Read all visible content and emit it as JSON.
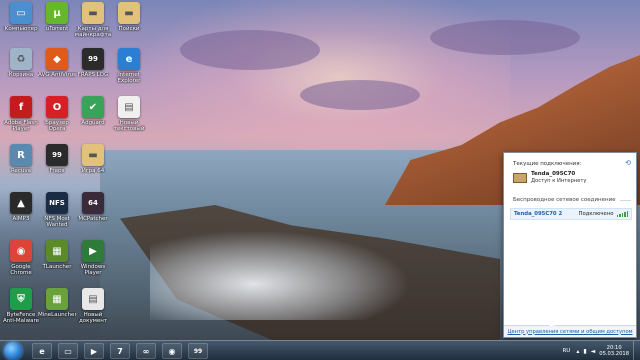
{
  "desktop": {
    "icons": [
      {
        "label": "Компьютер",
        "icon": "computer-icon",
        "color": "#4a8fd0",
        "glyph": "▭"
      },
      {
        "label": "Корзина",
        "icon": "recycle-bin-icon",
        "color": "#9fb4c8",
        "glyph": "♻"
      },
      {
        "label": "Adobe Flash Player",
        "icon": "flash-player-icon",
        "color": "#c21c1c",
        "glyph": "f"
      },
      {
        "label": "Recuva",
        "icon": "recuva-icon",
        "color": "#5a8ab0",
        "glyph": "R"
      },
      {
        "label": "AIMP3",
        "icon": "aimp-icon",
        "color": "#2a2a2a",
        "glyph": "▲"
      },
      {
        "label": "Google Chrome",
        "icon": "chrome-icon",
        "color": "#db4437",
        "glyph": "◉"
      },
      {
        "label": "ByteFence Anti-Malware",
        "icon": "bytefence-icon",
        "color": "#1e9e4a",
        "glyph": "⛨"
      },
      {
        "label": "uTorrent",
        "icon": "utorrent-icon",
        "color": "#67b72a",
        "glyph": "µ"
      },
      {
        "label": "AVG AntiVirus",
        "icon": "avg-icon",
        "color": "#e05a1a",
        "glyph": "◆"
      },
      {
        "label": "Браузер Opera",
        "icon": "opera-icon",
        "color": "#d81f26",
        "glyph": "O"
      },
      {
        "label": "Fraps",
        "icon": "fraps-icon",
        "color": "#2b2b2b",
        "glyph": "99"
      },
      {
        "label": "NFS Most Wanted",
        "icon": "nfs-icon",
        "color": "#1a2c44",
        "glyph": "NFS"
      },
      {
        "label": "TLauncher",
        "icon": "tlauncher-icon",
        "color": "#5a8a2a",
        "glyph": "▦"
      },
      {
        "label": "MineLauncher",
        "icon": "minelauncher-icon",
        "color": "#6aa23a",
        "glyph": "▦"
      },
      {
        "label": "Карты для майнкрафта",
        "icon": "folder-icon",
        "color": "#e2c27a",
        "glyph": "▬"
      },
      {
        "label": "FRAPS LOG",
        "icon": "fraps-log-icon",
        "color": "#2b2b2b",
        "glyph": "99"
      },
      {
        "label": "Adguard",
        "icon": "adguard-icon",
        "color": "#3aa35a",
        "glyph": "✔"
      },
      {
        "label": "Игра 64",
        "icon": "folder-icon",
        "color": "#e2c27a",
        "glyph": "▬"
      },
      {
        "label": "MCPatcher",
        "icon": "mcpatcher-icon",
        "color": "#3a2a3a",
        "glyph": "64"
      },
      {
        "label": "Windows Player",
        "icon": "media-player-icon",
        "color": "#2f7b3a",
        "glyph": "▶"
      },
      {
        "label": "Новый документ",
        "icon": "document-icon",
        "color": "#e8e8e8",
        "glyph": "▤"
      },
      {
        "label": "Пойски",
        "icon": "folder-icon",
        "color": "#e2c27a",
        "glyph": "▬"
      },
      {
        "label": "Internet Explorer",
        "icon": "ie-icon",
        "color": "#2b7fd3",
        "glyph": "e"
      },
      {
        "label": "Новый текстовый",
        "icon": "text-document-icon",
        "color": "#f0f0f0",
        "glyph": "▤"
      }
    ]
  },
  "network_popup": {
    "header": "Текущие подключения:",
    "current": {
      "name": "Tenda_095C70",
      "status": "Доступ к Интернету"
    },
    "section_title": "Беспроводное сетевое соединение",
    "wifi": {
      "name": "Tenda_095C70 2",
      "state": "Подключено"
    },
    "footer_link": "Центр управления сетями и общим доступом"
  },
  "taskbar": {
    "pinned": [
      {
        "icon": "ie-icon",
        "glyph": "e"
      },
      {
        "icon": "explorer-icon",
        "glyph": "▭"
      },
      {
        "icon": "media-player-icon",
        "glyph": "▶"
      },
      {
        "icon": "windows-logo-icon",
        "glyph": "7"
      },
      {
        "icon": "visual-studio-icon",
        "glyph": "∞"
      },
      {
        "icon": "chrome-icon",
        "glyph": "◉"
      },
      {
        "icon": "fraps-icon",
        "glyph": "99"
      }
    ],
    "tray": {
      "language": "RU",
      "time": "20:10",
      "date": "05.03.2018"
    }
  },
  "colors": {
    "accent": "#1f5da9",
    "signal": "#3ba03b"
  }
}
